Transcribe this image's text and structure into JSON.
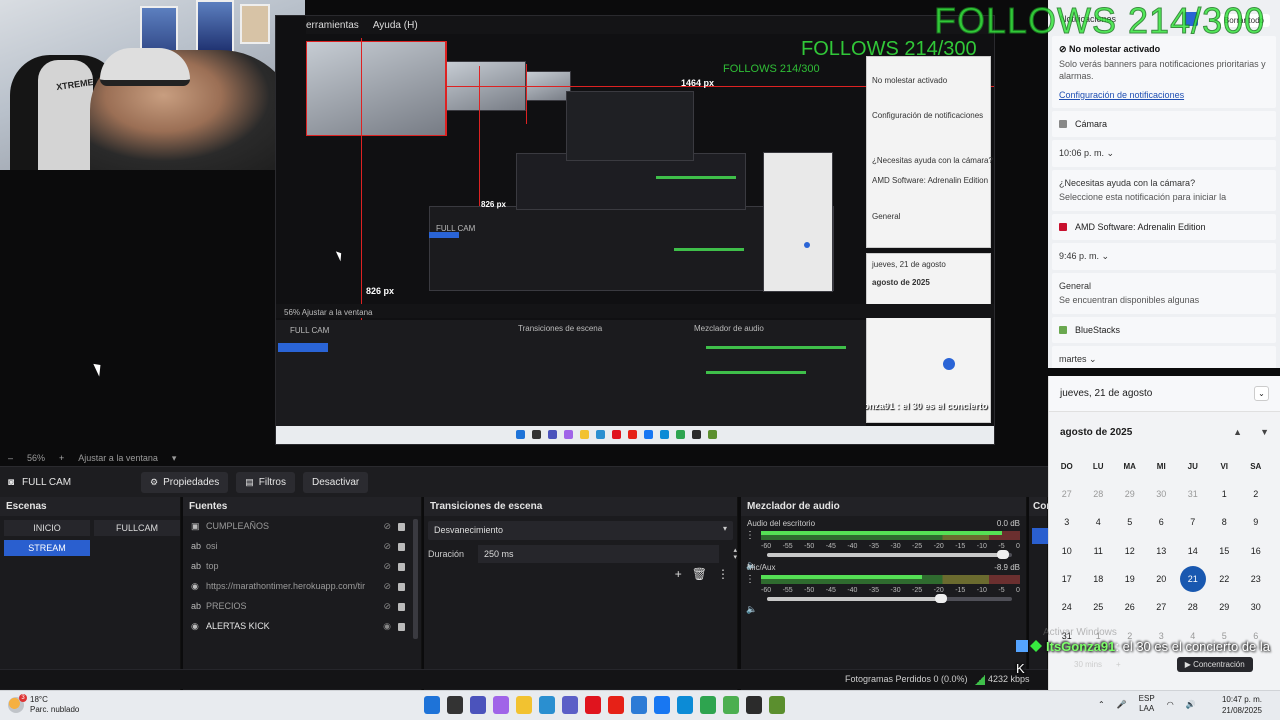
{
  "overlay": {
    "follows": "FOLLOWS 214/300",
    "nested_px_h": "1464 px",
    "nested_px_w": "826 px",
    "nested_px_small": "826 px"
  },
  "nested_menu": [
    "erramientas",
    "Ayuda (H)"
  ],
  "zoombar": {
    "minus": "–",
    "zoom": "56%",
    "plus": "+",
    "fit": "Ajustar a la ventana"
  },
  "scenebar": {
    "scene_name": "FULL CAM",
    "properties": "Propiedades",
    "filters": "Filtros",
    "deactivate": "Desactivar"
  },
  "scenes": {
    "title": "Escenas",
    "items": [
      {
        "label": "INICIO",
        "active": false
      },
      {
        "label": "FULLCAM",
        "active": false
      },
      {
        "label": "STREAM",
        "active": true
      }
    ]
  },
  "sources": {
    "title": "Fuentes",
    "items": [
      {
        "label": "CUMPLEAÑOS",
        "icon": "image-icon",
        "visible": false
      },
      {
        "label": "osi",
        "icon": "text-icon",
        "visible": false
      },
      {
        "label": "top",
        "icon": "text-icon",
        "visible": false
      },
      {
        "label": "https://marathontimer.herokuapp.com/tir",
        "icon": "browser-icon",
        "visible": false
      },
      {
        "label": "PRECIOS",
        "icon": "text-icon",
        "visible": false
      },
      {
        "label": "ALERTAS KICK",
        "icon": "browser-icon",
        "visible": true
      }
    ]
  },
  "transitions": {
    "title": "Transiciones de escena",
    "selected": "Desvanecimiento",
    "duration_label": "Duración",
    "duration_value": "250 ms"
  },
  "mixer": {
    "title": "Mezclador de audio",
    "channels": [
      {
        "name": "Audio del escritorio",
        "db": "0.0 dB",
        "level": 0.93,
        "volume": 0.97
      },
      {
        "name": "Mic/Aux",
        "db": "-8.9 dB",
        "level": 0.62,
        "volume": 0.72
      }
    ],
    "scale": [
      "-60",
      "-55",
      "-50",
      "-45",
      "-40",
      "-35",
      "-30",
      "-25",
      "-20",
      "-15",
      "-10",
      "-5",
      "0"
    ]
  },
  "controls": {
    "title": "Cor"
  },
  "status": {
    "frames": "Fotogramas Perdidos 0 (0.0%)",
    "kbps": "4232 kbps"
  },
  "notifications": {
    "header": "Notificaciones",
    "mode": "Borrar todo",
    "cards": [
      {
        "type": "dnd",
        "title": "No molestar activado",
        "body": "Solo verás banners para notificaciones prioritarias y alarmas.",
        "link": "Configuración de notificaciones"
      },
      {
        "type": "app",
        "app": "Cámara",
        "color": "#888888"
      },
      {
        "type": "time",
        "time": "10:06 p. m."
      },
      {
        "type": "msg",
        "title": "¿Necesitas ayuda con la cámara?",
        "body": "Seleccione esta notificación para iniciar la"
      },
      {
        "type": "app",
        "app": "AMD Software: Adrenalin Edition",
        "color": "#c8102e"
      },
      {
        "type": "time",
        "time": "9:46 p. m."
      },
      {
        "type": "msg",
        "title": "General",
        "body": "Se encuentran disponibles algunas"
      },
      {
        "type": "app",
        "app": "BlueStacks",
        "color": "#6aa84f"
      },
      {
        "type": "time",
        "time": "martes"
      }
    ]
  },
  "calendar": {
    "header_date": "jueves, 21 de agosto",
    "month": "agosto de 2025",
    "dows": [
      "DO",
      "LU",
      "MA",
      "MI",
      "JU",
      "VI",
      "SA"
    ],
    "days": [
      {
        "d": "27",
        "dim": true
      },
      {
        "d": "28",
        "dim": true
      },
      {
        "d": "29",
        "dim": true
      },
      {
        "d": "30",
        "dim": true
      },
      {
        "d": "31",
        "dim": true
      },
      {
        "d": "1"
      },
      {
        "d": "2"
      },
      {
        "d": "3"
      },
      {
        "d": "4"
      },
      {
        "d": "5"
      },
      {
        "d": "6"
      },
      {
        "d": "7"
      },
      {
        "d": "8"
      },
      {
        "d": "9"
      },
      {
        "d": "10"
      },
      {
        "d": "11"
      },
      {
        "d": "12"
      },
      {
        "d": "13"
      },
      {
        "d": "14"
      },
      {
        "d": "15"
      },
      {
        "d": "16"
      },
      {
        "d": "17"
      },
      {
        "d": "18"
      },
      {
        "d": "19"
      },
      {
        "d": "20"
      },
      {
        "d": "21",
        "today": true
      },
      {
        "d": "22"
      },
      {
        "d": "23"
      },
      {
        "d": "24"
      },
      {
        "d": "25"
      },
      {
        "d": "26"
      },
      {
        "d": "27"
      },
      {
        "d": "28"
      },
      {
        "d": "29"
      },
      {
        "d": "30"
      },
      {
        "d": "31"
      },
      {
        "d": "1",
        "dim": true
      },
      {
        "d": "2",
        "dim": true
      },
      {
        "d": "3",
        "dim": true
      },
      {
        "d": "4",
        "dim": true
      },
      {
        "d": "5",
        "dim": true
      },
      {
        "d": "6",
        "dim": true
      }
    ]
  },
  "focus": {
    "mins": "30 mins",
    "plus": "+",
    "label": "Concentración"
  },
  "chat": {
    "user": "ItsGonza91",
    "message": ": el 30 es el concierto de la K"
  },
  "watermark": "Activar Windows",
  "taskbar": {
    "weather_temp": "18°C",
    "weather_desc": "Parc. nublado",
    "weather_badge": "3",
    "lang_top": "ESP",
    "lang_bottom": "LAA",
    "time": "10:47 p. m.",
    "date": "21/08/2025",
    "apps": [
      {
        "name": "windows-start-icon",
        "color": "#1e73d8"
      },
      {
        "name": "task-view-icon",
        "color": "#333333"
      },
      {
        "name": "chat-icon",
        "color": "#4b53bc"
      },
      {
        "name": "copilot-icon",
        "color": "#a064e8"
      },
      {
        "name": "file-explorer-icon",
        "color": "#f2c230"
      },
      {
        "name": "edge-dev-icon",
        "color": "#2a8fd0"
      },
      {
        "name": "teams-icon",
        "color": "#5b5fc7"
      },
      {
        "name": "opera-icon",
        "color": "#e0141e"
      },
      {
        "name": "youtube-icon",
        "color": "#e62117"
      },
      {
        "name": "calculator-icon",
        "color": "#2d7bd6"
      },
      {
        "name": "facebook-icon",
        "color": "#1877f2"
      },
      {
        "name": "edge-icon",
        "color": "#0c8bd6"
      },
      {
        "name": "chrome-icon",
        "color": "#2ea44f"
      },
      {
        "name": "chrome-alt-icon",
        "color": "#4caf50"
      },
      {
        "name": "obs-icon",
        "color": "#2b2b2b"
      },
      {
        "name": "minecraft-icon",
        "color": "#5b8f2e"
      }
    ]
  }
}
